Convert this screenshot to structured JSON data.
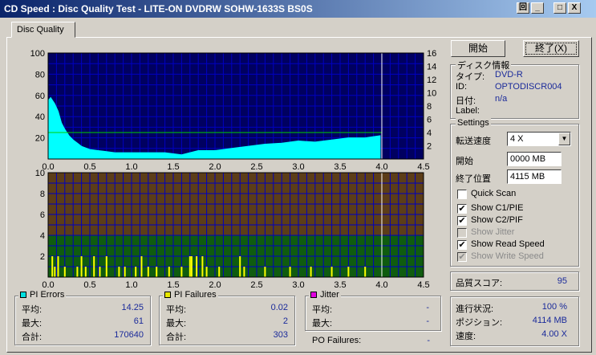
{
  "window": {
    "title": "CD Speed : Disc Quality Test - LITE-ON DVDRW SOHW-1633S BS0S"
  },
  "titlebar_buttons": [
    "回",
    "_",
    "□",
    "X"
  ],
  "tab": {
    "label": "Disc Quality"
  },
  "buttons": {
    "start": "開始",
    "stop": "終了(X)"
  },
  "disc_info": {
    "legend": "ディスク情報",
    "type_label": "タイプ:",
    "type_value": "DVD-R",
    "id_label": "ID:",
    "id_value": "OPTODISCR004",
    "date_label": "日付:",
    "date_value": "n/a",
    "label_label": "Label:",
    "label_value": ""
  },
  "settings": {
    "legend": "Settings",
    "speed_label": "転送速度",
    "speed_value": "4 X",
    "start_label": "開始",
    "start_value": "0000 MB",
    "end_label": "終了位置",
    "end_value": "4115 MB",
    "quick_scan": "Quick Scan",
    "show_c1": "Show C1/PIE",
    "show_c2": "Show C2/PIF",
    "show_jitter": "Show Jitter",
    "show_read": "Show Read Speed",
    "show_write": "Show Write Speed",
    "checkmark": "✔"
  },
  "quality": {
    "label": "品質スコア:",
    "value": "95"
  },
  "progress": {
    "progress_label": "進行状況:",
    "progress_value": "100 %",
    "position_label": "ポジション:",
    "position_value": "4114 MB",
    "speed_label": "速度:",
    "speed_value": "4.00 X"
  },
  "pi_errors": {
    "legend": "PI Errors",
    "color": "#00e0e0",
    "avg_label": "平均:",
    "avg_value": "14.25",
    "max_label": "最大:",
    "max_value": "61",
    "total_label": "合計:",
    "total_value": "170640"
  },
  "pi_failures": {
    "legend": "PI Failures",
    "color": "#e8e800",
    "avg_label": "平均:",
    "avg_value": "0.02",
    "max_label": "最大:",
    "max_value": "2",
    "total_label": "合計:",
    "total_value": "303"
  },
  "jitter": {
    "legend": "Jitter",
    "color": "#e000e0",
    "avg_label": "平均:",
    "avg_value": "-",
    "max_label": "最大:",
    "max_value": "-",
    "po_label": "PO Failures:",
    "po_value": "-"
  },
  "chart_data": [
    {
      "type": "area",
      "name": "PI Errors",
      "x_ticks": [
        "0.0",
        "0.5",
        "1.0",
        "1.5",
        "2.0",
        "2.5",
        "3.0",
        "3.5",
        "4.0",
        "4.5"
      ],
      "y_ticks": [
        20,
        40,
        60,
        80,
        100
      ],
      "y2_ticks": [
        2,
        4,
        6,
        8,
        10,
        12,
        14,
        16
      ],
      "xlim": [
        0,
        4.5
      ],
      "ylim": [
        0,
        100
      ],
      "y2lim": [
        0,
        16
      ],
      "grid": true,
      "colors": {
        "background": "#000060",
        "grid": "#0000c0",
        "fill": "#00ffff",
        "speed": "#00d000",
        "marker": "#ffffff"
      },
      "pi_profile": {
        "x": [
          0,
          0.03,
          0.08,
          0.12,
          0.16,
          0.2,
          0.25,
          0.3,
          0.35,
          0.4,
          0.5,
          0.6,
          0.7,
          0.8,
          0.9,
          1.0,
          1.2,
          1.4,
          1.6,
          1.7,
          1.8,
          2.0,
          2.2,
          2.4,
          2.6,
          2.8,
          3.0,
          3.2,
          3.4,
          3.6,
          3.8,
          3.98
        ],
        "y": [
          55,
          58,
          52,
          45,
          34,
          28,
          22,
          18,
          15,
          12,
          9,
          8,
          7,
          6,
          6,
          6,
          6,
          6,
          4,
          6,
          8,
          8,
          10,
          12,
          14,
          15,
          17,
          16,
          18,
          20,
          20,
          22
        ]
      },
      "read_speed": {
        "x": [
          0,
          4.0
        ],
        "y": [
          4,
          4
        ]
      },
      "end_marker": 4.0
    },
    {
      "type": "bar",
      "name": "PI Failures",
      "x_ticks": [
        "0.0",
        "0.5",
        "1.0",
        "1.5",
        "2.0",
        "2.5",
        "3.0",
        "3.5",
        "4.0",
        "4.5"
      ],
      "y_ticks": [
        2,
        4,
        6,
        8,
        10
      ],
      "xlim": [
        0,
        4.5
      ],
      "ylim": [
        0,
        10
      ],
      "grid": true,
      "colors": {
        "upper": "#5c3d18",
        "lower": "#0f5c0f",
        "grid": "#0000c0",
        "bar": "#ffff00",
        "marker": "#ffffff"
      },
      "threshold": 4,
      "spikes": [
        {
          "x": 0.05,
          "y": 2
        },
        {
          "x": 0.08,
          "y": 1
        },
        {
          "x": 0.12,
          "y": 2
        },
        {
          "x": 0.2,
          "y": 1
        },
        {
          "x": 0.35,
          "y": 1
        },
        {
          "x": 0.4,
          "y": 2
        },
        {
          "x": 0.45,
          "y": 1
        },
        {
          "x": 0.55,
          "y": 2
        },
        {
          "x": 0.62,
          "y": 1
        },
        {
          "x": 0.7,
          "y": 2
        },
        {
          "x": 0.85,
          "y": 1
        },
        {
          "x": 0.92,
          "y": 1
        },
        {
          "x": 1.05,
          "y": 1
        },
        {
          "x": 1.12,
          "y": 2
        },
        {
          "x": 1.2,
          "y": 1
        },
        {
          "x": 1.3,
          "y": 1
        },
        {
          "x": 1.45,
          "y": 1
        },
        {
          "x": 1.6,
          "y": 1
        },
        {
          "x": 1.7,
          "y": 2
        },
        {
          "x": 1.72,
          "y": 2
        },
        {
          "x": 1.78,
          "y": 2
        },
        {
          "x": 1.85,
          "y": 2
        },
        {
          "x": 1.9,
          "y": 1
        },
        {
          "x": 2.05,
          "y": 1
        },
        {
          "x": 2.3,
          "y": 2
        },
        {
          "x": 2.35,
          "y": 1
        },
        {
          "x": 2.6,
          "y": 1
        },
        {
          "x": 2.9,
          "y": 1
        },
        {
          "x": 3.15,
          "y": 1
        },
        {
          "x": 3.4,
          "y": 1
        },
        {
          "x": 3.6,
          "y": 1
        },
        {
          "x": 3.8,
          "y": 1
        }
      ],
      "end_marker": 4.0
    }
  ]
}
